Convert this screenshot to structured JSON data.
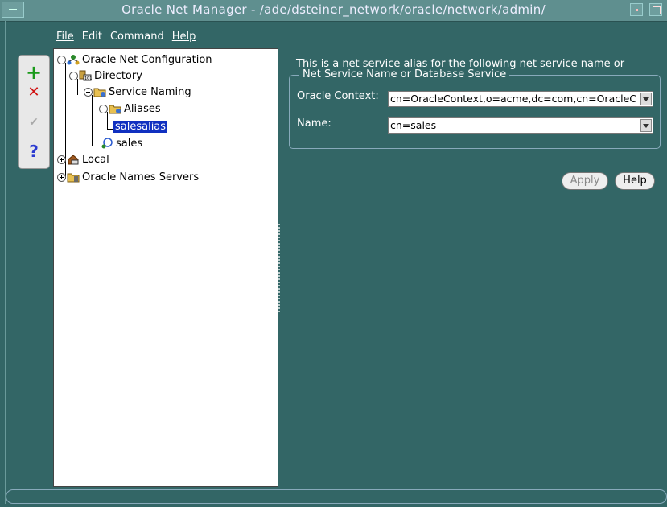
{
  "window": {
    "title": "Oracle Net Manager - /ade/dsteiner_network/oracle/network/admin/"
  },
  "menu": [
    "File",
    "Edit",
    "Command",
    "Help"
  ],
  "toolbar": {
    "create_symbol": "+",
    "delete_symbol": "✕",
    "test_symbol": "✔",
    "help_symbol": "?"
  },
  "tree": {
    "root": "Oracle Net Configuration",
    "directory": "Directory",
    "service_naming": "Service Naming",
    "aliases": "Aliases",
    "salesalias": "salesalias",
    "sales": "sales",
    "local": "Local",
    "names_servers": "Oracle Names Servers"
  },
  "detail": {
    "description": "This is a net service alias for the following net service name or",
    "group_label": "Net Service Name or Database Service",
    "oracle_context_label": "Oracle Context:",
    "oracle_context_value": "cn=OracleContext,o=acme,dc=com,cn=OracleC",
    "name_label": "Name:",
    "name_value": "cn=sales",
    "apply_label": "Apply",
    "help_label": "Help"
  },
  "colors": {
    "background": "#336666",
    "selection": "#1030c0"
  }
}
